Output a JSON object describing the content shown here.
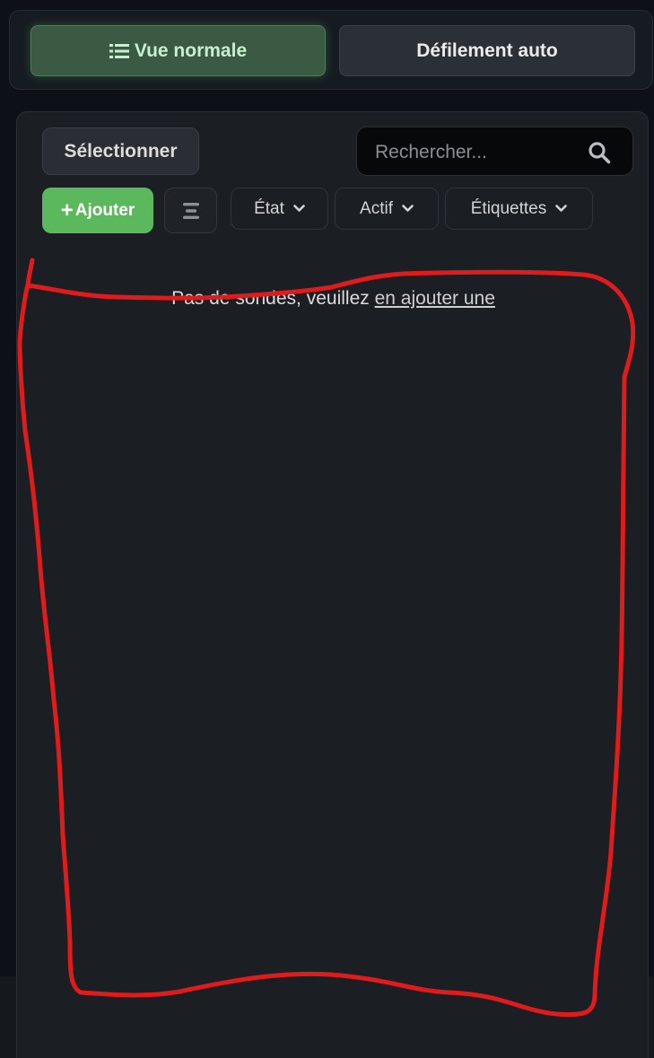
{
  "view_switcher": {
    "normal_label": "Vue normale",
    "auto_scroll_label": "Défilement auto"
  },
  "toolbar": {
    "select_label": "Sélectionner",
    "search_placeholder": "Rechercher...",
    "add_label": "Ajouter",
    "filters": [
      "État",
      "Actif",
      "Étiquettes"
    ]
  },
  "empty_state": {
    "message": "Pas de sondes, veuillez",
    "link_text": "en ajouter une"
  },
  "colors": {
    "accent_green": "#5cb85c",
    "annotation_red": "#e01b1b"
  },
  "icons": [
    "list-icon",
    "search-icon",
    "plus-icon",
    "sort-icon",
    "chevron-down-icon"
  ]
}
